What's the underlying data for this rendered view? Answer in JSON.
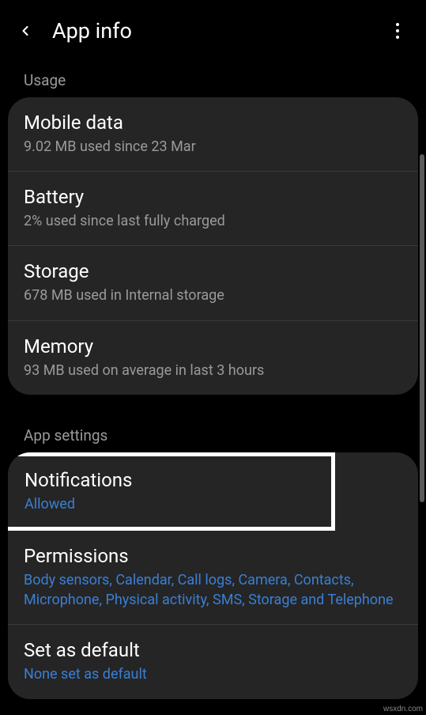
{
  "header": {
    "title": "App info"
  },
  "sections": {
    "usage": {
      "label": "Usage",
      "items": [
        {
          "title": "Mobile data",
          "subtitle": "9.02 MB used since 23 Mar"
        },
        {
          "title": "Battery",
          "subtitle": "2% used since last fully charged"
        },
        {
          "title": "Storage",
          "subtitle": "678 MB used in Internal storage"
        },
        {
          "title": "Memory",
          "subtitle": "93 MB used on average in last 3 hours"
        }
      ]
    },
    "app_settings": {
      "label": "App settings",
      "items": [
        {
          "title": "Notifications",
          "subtitle": "Allowed"
        },
        {
          "title": "Permissions",
          "subtitle": "Body sensors, Calendar, Call logs, Camera, Contacts, Microphone, Physical activity, SMS, Storage and Telephone"
        },
        {
          "title": "Set as default",
          "subtitle": "None set as default"
        }
      ]
    }
  },
  "watermark": "wsxdn.com"
}
